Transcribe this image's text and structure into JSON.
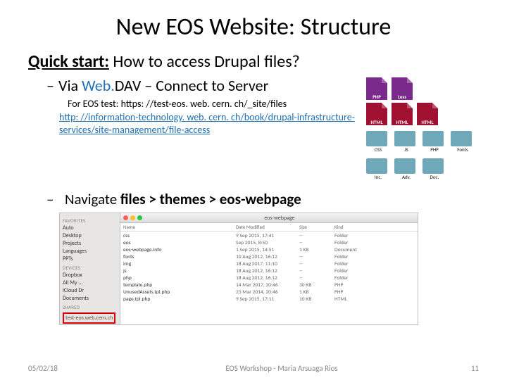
{
  "title": "New EOS Website: Structure",
  "quick": {
    "label": "Quick start:",
    "rest": " How to access Drupal files?"
  },
  "bullet1": {
    "pre": "Via ",
    "web": "Web.",
    "rest": "DAV – Connect to Server"
  },
  "subline": "For EOS test: https: //test-eos. web. cern. ch/_site/files",
  "link": "http: //information-technology. web. cern. ch/book/drupal-infrastructure-services/site-management/file-access",
  "navline": {
    "pre": "Navigate ",
    "bold": "files > themes > eos-webpage"
  },
  "file_icons": {
    "row1": [
      "PHP",
      "Less"
    ],
    "row2": [
      "HTML",
      "HTML",
      "HTML"
    ]
  },
  "folders": [
    "CSS",
    "JS",
    "PHP",
    "Fonts",
    "Inc.",
    "Adv.",
    "Doc."
  ],
  "finder": {
    "title": "eos-webpage",
    "sidebar": {
      "favorites": "Favorites",
      "items": [
        "Auto",
        "Desktop",
        "Projects",
        "Languages",
        "PPTs"
      ],
      "devices": "Devices",
      "devitems": [
        "Dropbox",
        "All My ...",
        "iCloud Dr",
        "Documents"
      ],
      "shared_label": "Shared",
      "shared_item": "test-eos.web.cern.ch"
    },
    "cols": [
      "Name",
      "Date Modified",
      "Size",
      "Kind"
    ],
    "rows": [
      {
        "n": "css",
        "d": "9 Sep 2015, 17:41",
        "s": "--",
        "k": "Folder"
      },
      {
        "n": "eos",
        "d": "Sep 2015, 8:50",
        "s": "--",
        "k": "Folder"
      },
      {
        "n": "eos-webpage.info",
        "d": "1 Sep 2015, 14:51",
        "s": "1 KB",
        "k": "Document"
      },
      {
        "n": "fonts",
        "d": "10 Aug 2012, 16:12",
        "s": "--",
        "k": "Folder"
      },
      {
        "n": "img",
        "d": "18 Aug 2017, 11:10",
        "s": "--",
        "k": "Folder"
      },
      {
        "n": "js",
        "d": "18 Aug 2012, 16:12",
        "s": "--",
        "k": "Folder"
      },
      {
        "n": "php",
        "d": "18 Aug 2012, 16:12",
        "s": "--",
        "k": "Folder"
      },
      {
        "n": "template.php",
        "d": "14 Mar 2017, 20:46",
        "s": "30 KB",
        "k": "PHP"
      },
      {
        "n": "UnusedAssets.tpl.php",
        "d": "23 Mar 2014, 20:46",
        "s": "1 KB",
        "k": "PHP"
      },
      {
        "n": "page.tpl.php",
        "d": "9 Sep 2015, 17:11",
        "s": "10 KB",
        "k": "HTML"
      }
    ]
  },
  "footer": {
    "date": "05/02/18",
    "mid": "EOS Workshop - Maria Arsuaga Rios",
    "page": "11"
  }
}
